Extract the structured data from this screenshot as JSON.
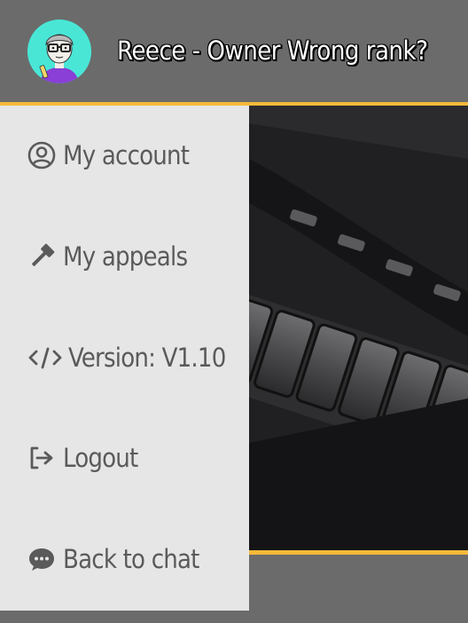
{
  "header": {
    "title": "Reece - Owner Wrong rank?",
    "avatar_icon": "user-avatar-glasses"
  },
  "menu": {
    "items": [
      {
        "label": "My account",
        "icon": "user-circle-icon"
      },
      {
        "label": "My appeals",
        "icon": "gavel-icon"
      },
      {
        "label": "Version: V1.10",
        "icon": "code-icon"
      },
      {
        "label": "Logout",
        "icon": "logout-icon"
      },
      {
        "label": "Back to chat",
        "icon": "chat-bubble-icon"
      }
    ]
  },
  "colors": {
    "header_bg": "#6b6b6b",
    "accent": "#f5b93a",
    "sidebar_bg": "#e6e6e6",
    "menu_text": "#5a5a5a",
    "avatar_bg": "#49e6d6"
  }
}
